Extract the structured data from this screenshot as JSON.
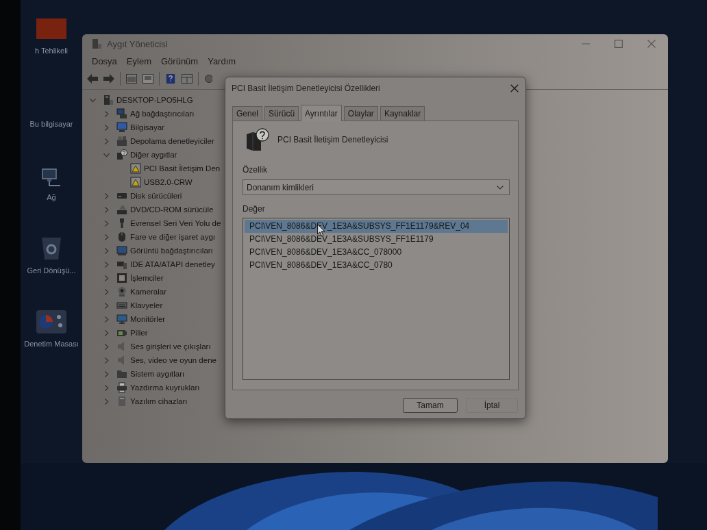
{
  "desktop": {
    "icons": [
      {
        "label": "h Tehlikeli"
      },
      {
        "label": "Bu bilgisayar"
      },
      {
        "label": "Ağ"
      },
      {
        "label": "Geri Dönüşü..."
      },
      {
        "label": "Denetim Masası"
      }
    ]
  },
  "window": {
    "title": "Aygıt Yöneticisi",
    "menu": [
      "Dosya",
      "Eylem",
      "Görünüm",
      "Yardım"
    ],
    "tree": {
      "label": "DESKTOP-LPO5HLG",
      "kind": "computer",
      "expanded": true,
      "children": [
        {
          "label": "Ağ bağdaştırıcıları",
          "kind": "category",
          "expanded": false
        },
        {
          "label": "Bilgisayar",
          "kind": "category",
          "expanded": false
        },
        {
          "label": "Depolama denetleyiciler",
          "kind": "category",
          "expanded": false
        },
        {
          "label": "Diğer aygıtlar",
          "kind": "category",
          "expanded": true,
          "children": [
            {
              "label": "PCI Basit İletişim Den",
              "kind": "device"
            },
            {
              "label": "USB2.0-CRW",
              "kind": "device"
            }
          ]
        },
        {
          "label": "Disk sürücüleri",
          "kind": "category",
          "expanded": false
        },
        {
          "label": "DVD/CD-ROM sürücüle",
          "kind": "category",
          "expanded": false
        },
        {
          "label": "Evrensel Seri Veri Yolu de",
          "kind": "category",
          "expanded": false
        },
        {
          "label": "Fare ve diğer işaret aygı",
          "kind": "category",
          "expanded": false
        },
        {
          "label": "Görüntü bağdaştırıcıları",
          "kind": "category",
          "expanded": false
        },
        {
          "label": "IDE ATA/ATAPI denetley",
          "kind": "category",
          "expanded": false
        },
        {
          "label": "İşlemciler",
          "kind": "category",
          "expanded": false
        },
        {
          "label": "Kameralar",
          "kind": "category",
          "expanded": false
        },
        {
          "label": "Klavyeler",
          "kind": "category",
          "expanded": false
        },
        {
          "label": "Monitörler",
          "kind": "category",
          "expanded": false
        },
        {
          "label": "Piller",
          "kind": "category",
          "expanded": false
        },
        {
          "label": "Ses girişleri ve çıkışları",
          "kind": "category",
          "expanded": false
        },
        {
          "label": "Ses, video ve oyun dene",
          "kind": "category",
          "expanded": false
        },
        {
          "label": "Sistem aygıtları",
          "kind": "category",
          "expanded": false
        },
        {
          "label": "Yazdırma kuyrukları",
          "kind": "category",
          "expanded": false
        },
        {
          "label": "Yazılım cihazları",
          "kind": "category",
          "expanded": false
        }
      ]
    }
  },
  "dialog": {
    "title": "PCI Basit İletişim Denetleyicisi Özellikleri",
    "tabs": [
      {
        "label": "Genel",
        "selected": false
      },
      {
        "label": "Sürücü",
        "selected": false
      },
      {
        "label": "Ayrıntılar",
        "selected": true
      },
      {
        "label": "Olaylar",
        "selected": false
      },
      {
        "label": "Kaynaklar",
        "selected": false
      }
    ],
    "device_name": "PCI Basit İletişim Denetleyicisi",
    "property_label": "Özellik",
    "property": {
      "value": "Donanım kimlikleri"
    },
    "value_label": "Değer",
    "values": [
      {
        "text": "PCI\\VEN_8086&DEV_1E3A&SUBSYS_FF1E1179&REV_04",
        "selected": true
      },
      {
        "text": "PCI\\VEN_8086&DEV_1E3A&SUBSYS_FF1E1179",
        "selected": false
      },
      {
        "text": "PCI\\VEN_8086&DEV_1E3A&CC_078000",
        "selected": false
      },
      {
        "text": "PCI\\VEN_8086&DEV_1E3A&CC_0780",
        "selected": false
      }
    ],
    "buttons": [
      {
        "label": "Tamam",
        "kind": "default"
      },
      {
        "label": "İptal",
        "kind": "normal"
      }
    ]
  }
}
